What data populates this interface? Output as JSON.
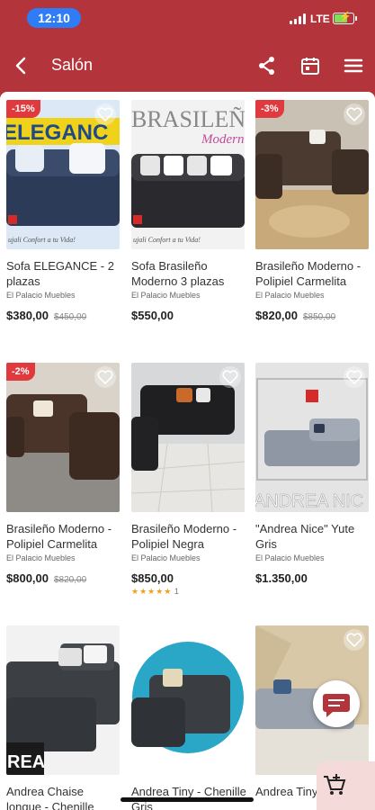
{
  "status_bar": {
    "time": "12:10",
    "network": "LTE"
  },
  "app_bar": {
    "title": "Salón"
  },
  "products": [
    {
      "name": "Sofa ELEGANCE - 2 plazas",
      "store": "El Palacio Muebles",
      "price": "$380,00",
      "old_price": "$450,00",
      "discount": "-15%",
      "image_text": "ELEGANC",
      "image_sub": "ujali Confort a tu Vida!"
    },
    {
      "name": "Sofa Brasileño Moderno 3 plazas",
      "store": "El Palacio Muebles",
      "price": "$550,00",
      "image_text": "BRASILEÑO",
      "image_sub": "Moderno",
      "image_sub2": "ujali Confort a tu Vida!"
    },
    {
      "name": "Brasileño Moderno - Polipiel Carmelita",
      "store": "El Palacio Muebles",
      "price": "$820,00",
      "old_price": "$850,00",
      "discount": "-3%"
    },
    {
      "name": "Brasileño Moderno - Polipiel Carmelita",
      "store": "El Palacio Muebles",
      "price": "$800,00",
      "old_price": "$820,00",
      "discount": "-2%"
    },
    {
      "name": "Brasileño Moderno - Polipiel Negra",
      "store": "El Palacio Muebles",
      "price": "$850,00",
      "rating_count": "1"
    },
    {
      "name": "\"Andrea Nice\" Yute Gris",
      "store": "El Palacio Muebles",
      "price": "$1.350,00",
      "image_text": "ANDREA NIC"
    },
    {
      "name": "Andrea Chaise longue - Chenille",
      "image_text": "REA"
    },
    {
      "name": "Andrea Tiny - Chenille Gris"
    },
    {
      "name": "Andrea Tiny - chais"
    }
  ],
  "colors": {
    "brand": "#b3343a",
    "discount": "#e0393e",
    "star": "#f0a020"
  }
}
